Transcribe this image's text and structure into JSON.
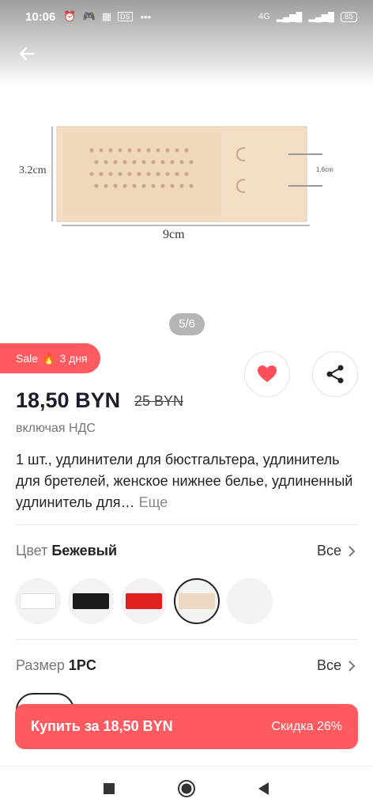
{
  "status_bar": {
    "time": "10:06",
    "network": "4G",
    "battery": "85"
  },
  "gallery": {
    "dimension_height": "3.2cm",
    "dimension_width": "9cm",
    "dimension_small": "1.6cm",
    "pager": "5/6"
  },
  "sale": {
    "label": "Sale",
    "duration": "3 дня"
  },
  "price": {
    "current": "18,50 BYN",
    "old": "25 BYN",
    "vat_note": "включая НДС"
  },
  "description": {
    "text": "1 шт., удлинители для бюстгальтера, удлинитель для бретелей, женское нижнее белье, удлиненный удлинитель для…",
    "more": "Еще"
  },
  "color": {
    "label": "Цвет",
    "value": "Бежевый",
    "all": "Все",
    "swatches": [
      {
        "name": "white",
        "color": "#ffffff"
      },
      {
        "name": "black",
        "color": "#1a1a1a"
      },
      {
        "name": "red",
        "color": "#e0201f"
      },
      {
        "name": "beige",
        "color": "#efd9c2",
        "selected": true
      },
      {
        "name": "empty",
        "color": "#f3f3f3"
      }
    ]
  },
  "size": {
    "label": "Размер",
    "value": "1PC",
    "all": "Все"
  },
  "buy": {
    "label": "Купить за 18,50 BYN",
    "discount": "Скидка 26%"
  },
  "colors": {
    "accent": "#ff5a5f",
    "heart": "#ff4d5a",
    "product": "#f3ddc4"
  }
}
